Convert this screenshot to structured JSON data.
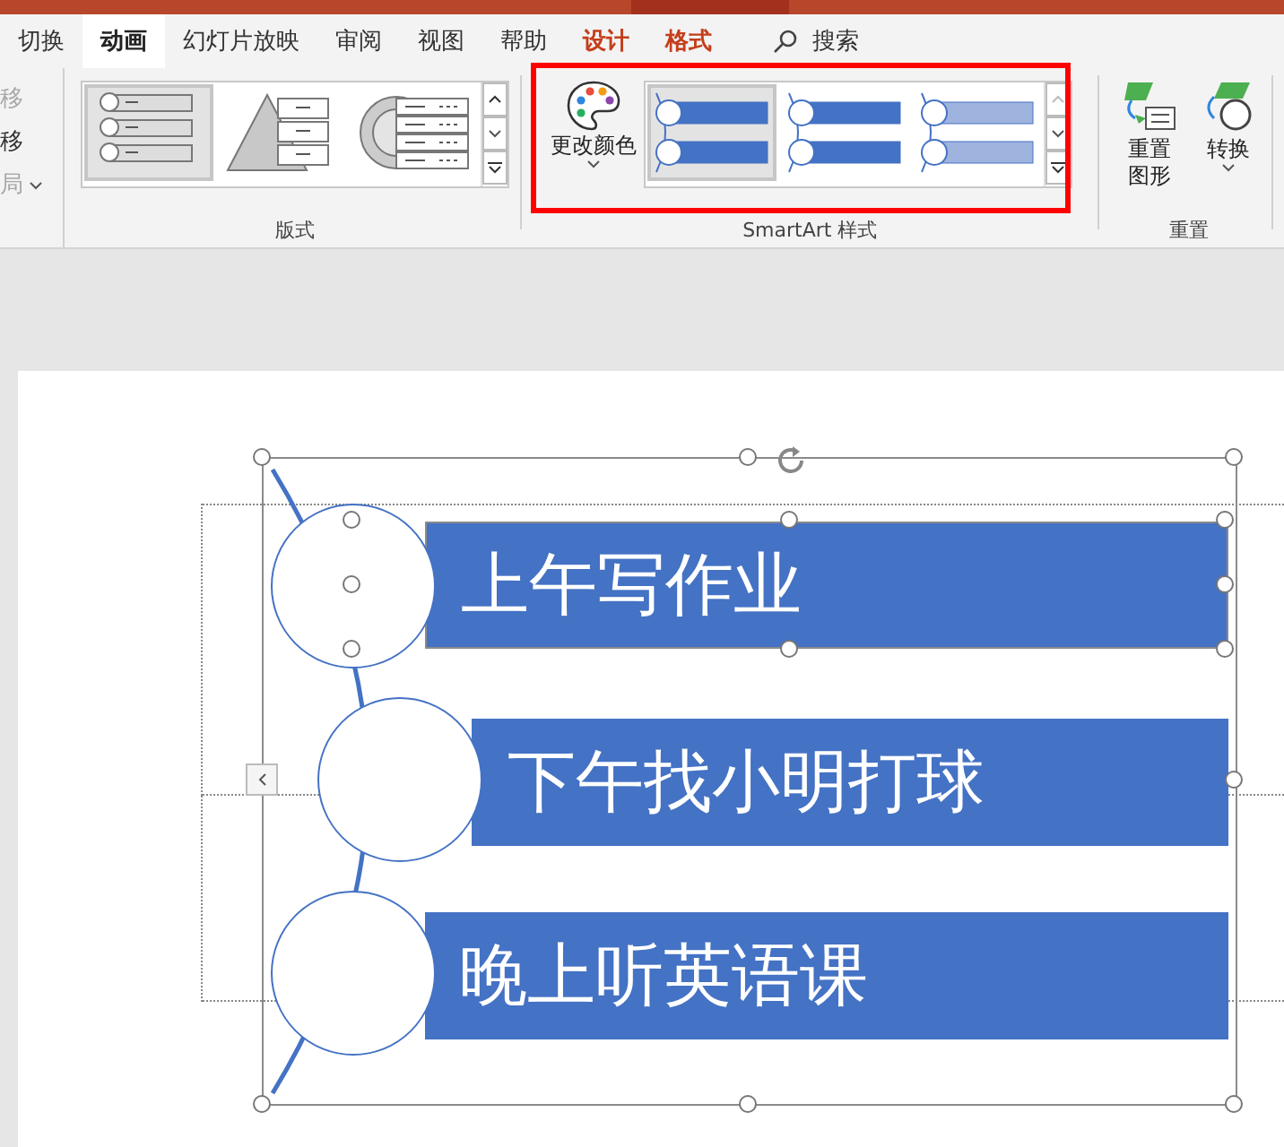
{
  "tabs": [
    {
      "label": "切换",
      "selected": false,
      "kind": "normal"
    },
    {
      "label": "动画",
      "selected": true,
      "kind": "normal"
    },
    {
      "label": "幻灯片放映",
      "selected": false,
      "kind": "normal"
    },
    {
      "label": "审阅",
      "selected": false,
      "kind": "normal"
    },
    {
      "label": "视图",
      "selected": false,
      "kind": "normal"
    },
    {
      "label": "帮助",
      "selected": false,
      "kind": "normal"
    },
    {
      "label": "设计",
      "selected": false,
      "kind": "contextual"
    },
    {
      "label": "格式",
      "selected": false,
      "kind": "contextual"
    }
  ],
  "search": {
    "label": "搜索"
  },
  "ribbon": {
    "cut_group": [
      {
        "label": "移",
        "disabled": true,
        "has_menu": false
      },
      {
        "label": "移",
        "disabled": false,
        "has_menu": false
      },
      {
        "label": "局",
        "disabled": true,
        "has_menu": true
      }
    ],
    "layouts": {
      "label": "版式",
      "thumbnails": [
        {
          "kind": "vertical-list",
          "selected": true
        },
        {
          "kind": "pyramid",
          "selected": false
        },
        {
          "kind": "target-list",
          "selected": false
        }
      ]
    },
    "change_colors": {
      "label": "更改颜色"
    },
    "styles": {
      "label": "SmartArt 样式",
      "thumbnails": [
        {
          "kind": "flat",
          "selected": true
        },
        {
          "kind": "flat",
          "selected": false
        },
        {
          "kind": "gradient",
          "selected": false
        }
      ]
    },
    "reset": {
      "label": "重置",
      "buttons": [
        {
          "label": "重置图形",
          "kind": "reset"
        },
        {
          "label": "转换",
          "kind": "convert"
        }
      ]
    }
  },
  "slide": {
    "items": [
      {
        "text": "上午写作业",
        "selected": true
      },
      {
        "text": "下午找小明打球",
        "selected": false
      },
      {
        "text": "晚上听英语课",
        "selected": false
      }
    ]
  }
}
